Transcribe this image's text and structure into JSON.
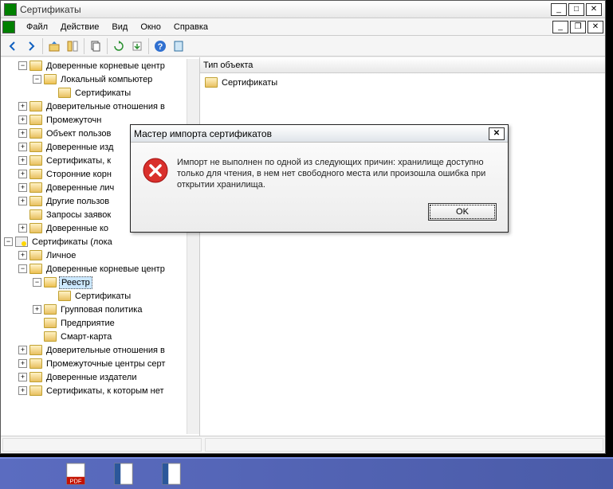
{
  "titlebar": {
    "title": "Сертификаты"
  },
  "menu": {
    "file": "Файл",
    "action": "Действие",
    "view": "Вид",
    "window": "Окно",
    "help": "Справка"
  },
  "tree": {
    "n1": "Доверенные корневые центр",
    "n2": "Локальный компьютер",
    "n3": "Сертификаты",
    "n4": "Доверительные отношения в",
    "n5": "Промежуточн",
    "n6": "Объект пользов",
    "n7": "Доверенные изд",
    "n8": "Сертификаты, к",
    "n9": "Сторонние корн",
    "n10": "Доверенные лич",
    "n11": "Другие пользов",
    "n12": "Запросы заявок",
    "n13": "Доверенные ко",
    "n14": "Сертификаты (лока",
    "n15": "Личное",
    "n16": "Доверенные корневые центр",
    "n17": "Реестр",
    "n18": "Сертификаты",
    "n19": "Групповая политика",
    "n20": "Предприятие",
    "n21": "Смарт-карта",
    "n22": "Доверительные отношения в",
    "n23": "Промежуточные центры серт",
    "n24": "Доверенные издатели",
    "n25": "Сертификаты, к которым нет"
  },
  "list": {
    "header": "Тип объекта",
    "item1": "Сертификаты"
  },
  "dialog": {
    "title": "Мастер импорта сертификатов",
    "text": "Импорт не выполнен по одной из следующих причин: хранилище доступно только для чтения, в нем нет свободного места или произошла ошибка при открытии хранилища.",
    "ok": "OK"
  }
}
